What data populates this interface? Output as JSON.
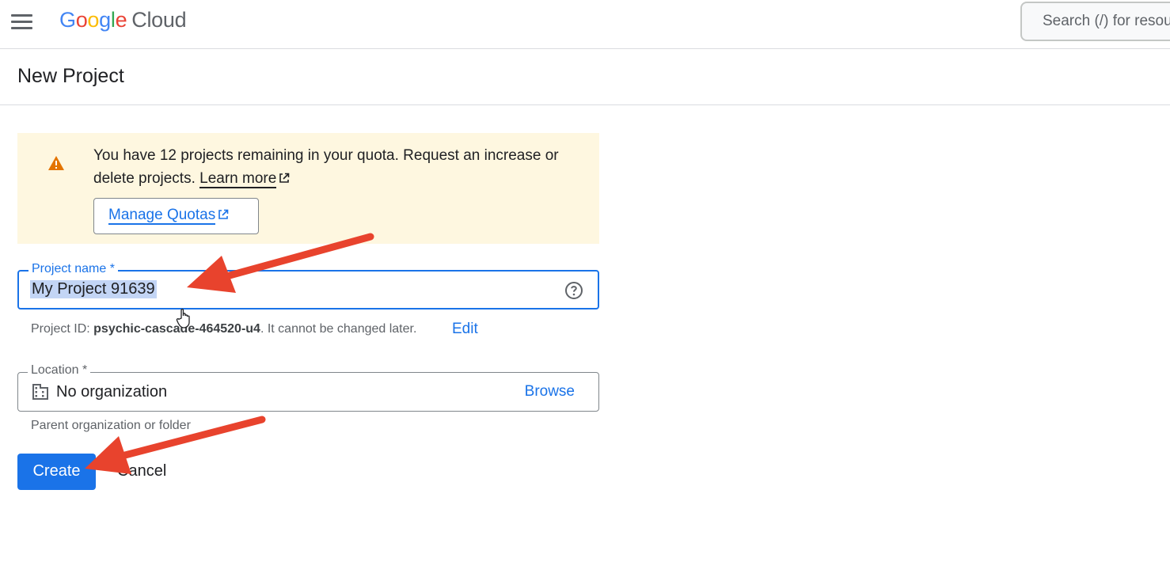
{
  "header": {
    "logo": {
      "g1": "G",
      "g2": "o",
      "g3": "o",
      "g4": "g",
      "g5": "l",
      "g6": "e",
      "cloud": "Cloud"
    },
    "search_placeholder": "Search (/) for resources"
  },
  "page": {
    "title": "New Project"
  },
  "quota": {
    "message": "You have 12 projects remaining in your quota. Request an increase or delete projects.",
    "learn_more": "Learn more",
    "manage_quotas": "Manage Quotas"
  },
  "project_name": {
    "label": "Project name *",
    "value": "My Project 91639"
  },
  "project_id": {
    "prefix": "Project ID:",
    "id": "psychic-cascade-464520-u4",
    "suffix": ". It cannot be changed later.",
    "edit": "Edit"
  },
  "location": {
    "label": "Location *",
    "value": "No organization",
    "browse": "Browse",
    "helper": "Parent organization or folder"
  },
  "actions": {
    "create": "Create",
    "cancel": "Cancel"
  },
  "colors": {
    "accent": "#1a73e8",
    "warning_bg": "#fef7e0",
    "warning_icon": "#e37400",
    "annotation_arrow": "#e8432d"
  },
  "icons": [
    "menu-icon",
    "warning-icon",
    "external-link-icon",
    "help-icon",
    "building-icon",
    "hand-cursor-icon"
  ]
}
